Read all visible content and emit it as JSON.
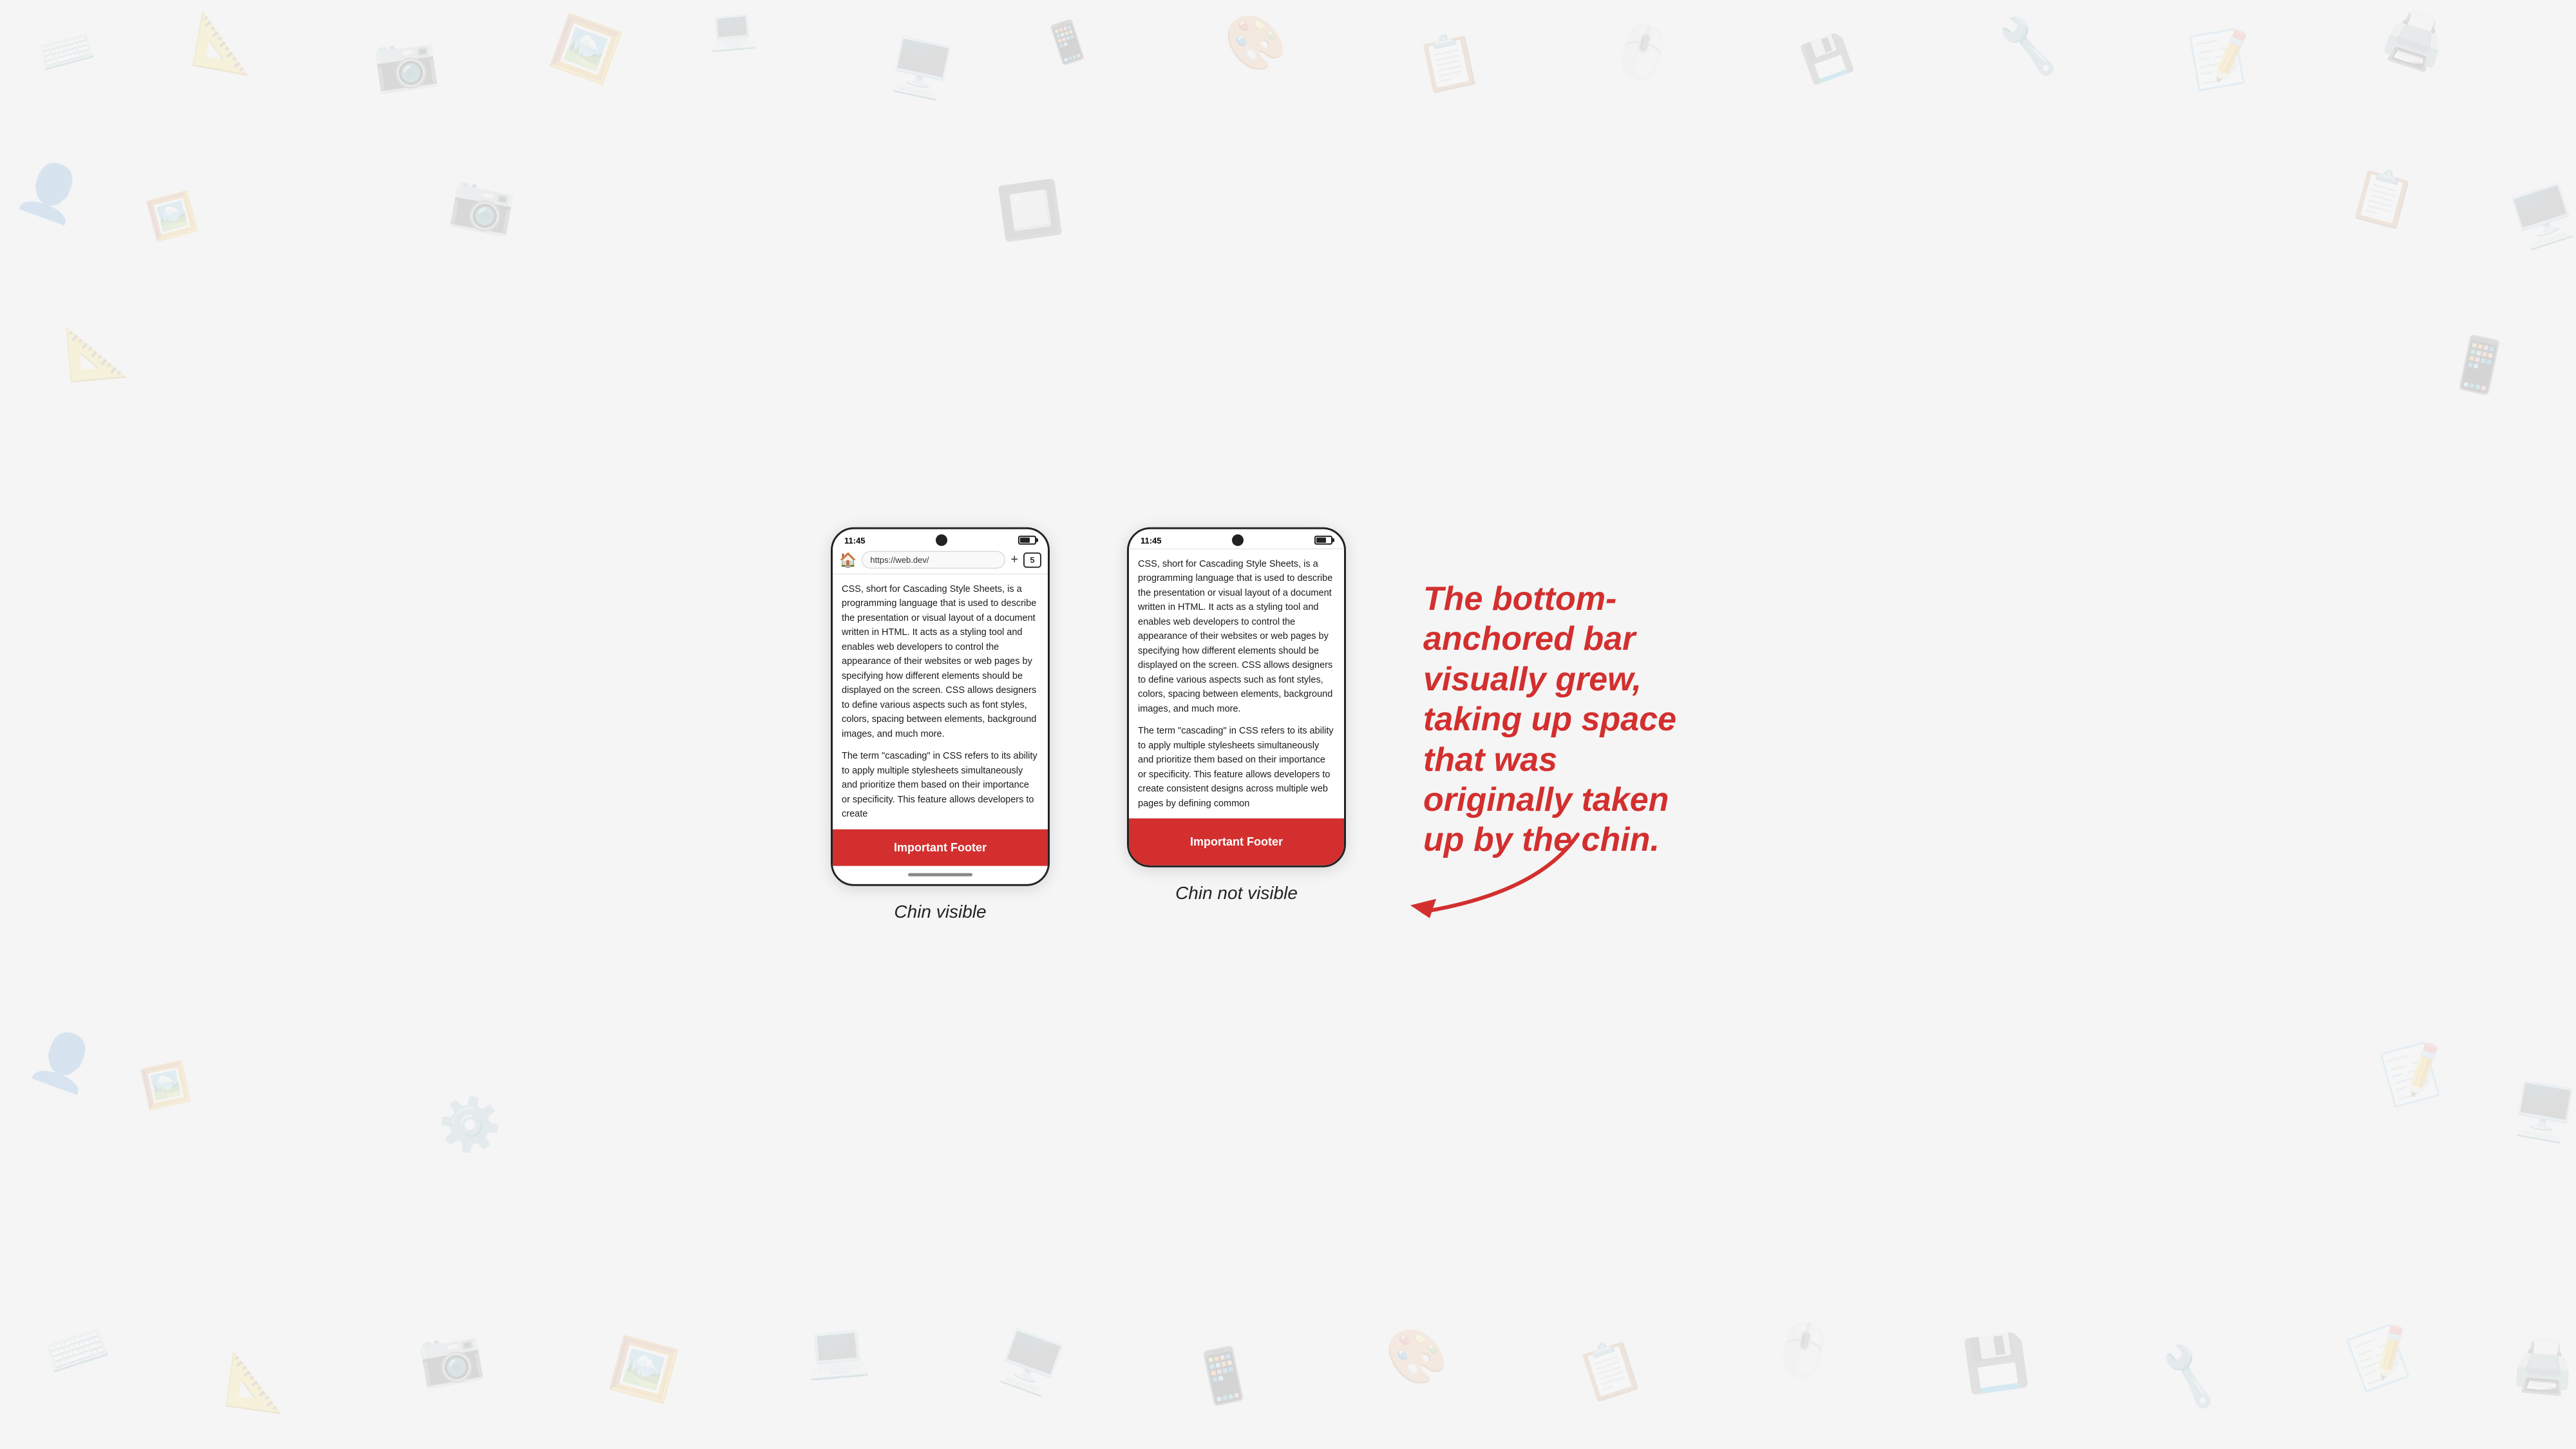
{
  "background": {
    "color": "#f5f5f5"
  },
  "phone1": {
    "status": {
      "time": "11:45",
      "battery_label": "battery"
    },
    "address_bar": {
      "url": "https://web.dev/",
      "tab_count": "5"
    },
    "content_paragraphs": [
      "CSS, short for Cascading Style Sheets, is a programming language that is used to describe the presentation or visual layout of a document written in HTML. It acts as a styling tool and enables web developers to control the appearance of their websites or web pages by specifying how different elements should be displayed on the screen. CSS allows designers to define various aspects such as font styles, colors, spacing between elements, background images, and much more.",
      "The term \"cascading\" in CSS refers to its ability to apply multiple stylesheets simultaneously and prioritize them based on their importance or specificity. This feature allows developers to create"
    ],
    "footer_label": "Important Footer",
    "chin_visible": true,
    "label": "Chin visible"
  },
  "phone2": {
    "status": {
      "time": "11:45",
      "battery_label": "battery"
    },
    "content_paragraphs": [
      "CSS, short for Cascading Style Sheets, is a programming language that is used to describe the presentation or visual layout of a document written in HTML. It acts as a styling tool and enables web developers to control the appearance of their websites or web pages by specifying how different elements should be displayed on the screen. CSS allows designers to define various aspects such as font styles, colors, spacing between elements, background images, and much more.",
      "The term \"cascading\" in CSS refers to its ability to apply multiple stylesheets simultaneously and prioritize them based on their importance or specificity. This feature allows developers to create consistent designs across multiple web pages by defining common"
    ],
    "footer_label": "Important Footer",
    "chin_visible": false,
    "label": "Chin not visible"
  },
  "annotation": {
    "line1": "The bottom-",
    "line2": "anchored bar",
    "line3": "visually grew,",
    "line4": "taking up space",
    "line5": "that was",
    "line6": "originally taken",
    "line7": "up by the chin."
  },
  "icons": {
    "home": "🏠",
    "add_tab": "+",
    "tab_count": "5"
  }
}
